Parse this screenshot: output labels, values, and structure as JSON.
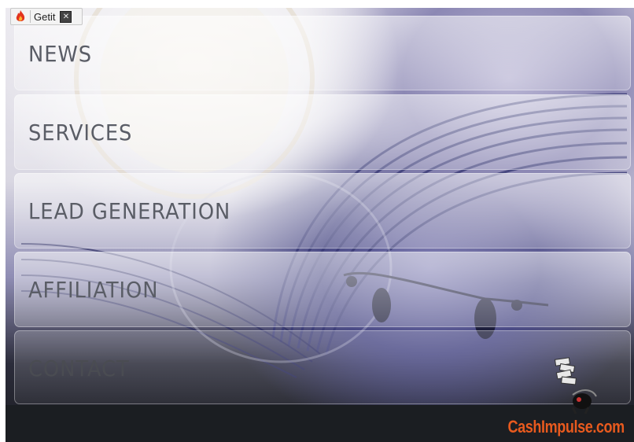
{
  "toolbar": {
    "getit_label": "Getit",
    "close_symbol": "✕",
    "icons": [
      "flame-icon",
      "close-icon"
    ]
  },
  "menu": {
    "items": [
      {
        "label": "NEWS"
      },
      {
        "label": "SERVICES"
      },
      {
        "label": "LEAD GENERATION"
      },
      {
        "label": "AFFILIATION"
      },
      {
        "label": "CONTACT"
      }
    ]
  },
  "footer": {
    "logo": "CashImpulse.com"
  },
  "colors": {
    "logo": "#e85a1e",
    "label": "#5a5d66",
    "background_dark": "#1b1e22"
  }
}
